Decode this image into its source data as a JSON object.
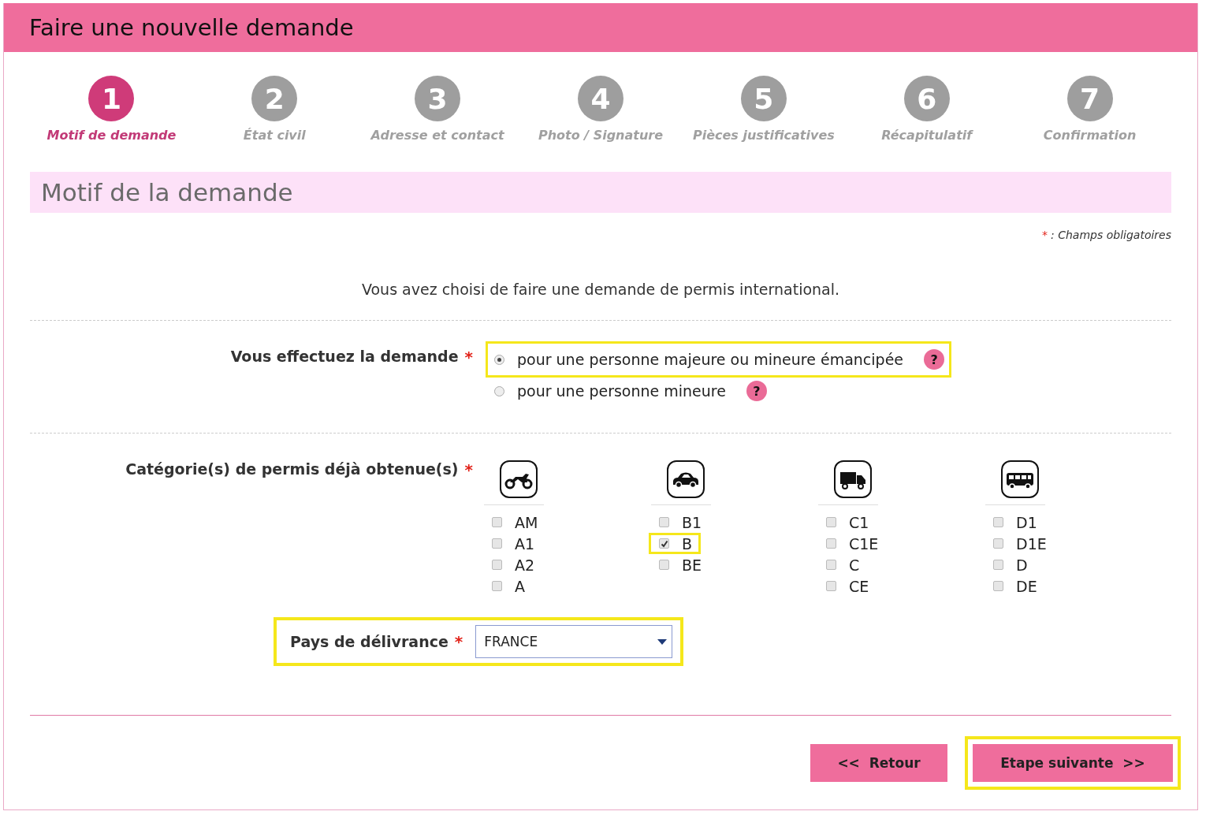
{
  "header": {
    "title": "Faire une nouvelle demande"
  },
  "steps": [
    {
      "number": "1",
      "label": "Motif de demande",
      "selected": true
    },
    {
      "number": "2",
      "label": "État civil",
      "selected": false
    },
    {
      "number": "3",
      "label": "Adresse et contact",
      "selected": false
    },
    {
      "number": "4",
      "label": "Photo / Signature",
      "selected": false
    },
    {
      "number": "5",
      "label": "Pièces justificatives",
      "selected": false
    },
    {
      "number": "6",
      "label": "Récapitulatif",
      "selected": false
    },
    {
      "number": "7",
      "label": "Confirmation",
      "selected": false
    }
  ],
  "section_title": "Motif de la demande",
  "required_note": {
    "mark": "*",
    "text": ": Champs obligatoires"
  },
  "intro": "Vous avez choisi de faire une demande de permis international.",
  "requester": {
    "label": "Vous effectuez la demande",
    "required": "*",
    "options": [
      {
        "label": "pour une personne majeure ou mineure émancipée",
        "selected": true,
        "highlighted": true,
        "help": "?"
      },
      {
        "label": "pour une personne mineure",
        "selected": false,
        "highlighted": false,
        "help": "?"
      }
    ]
  },
  "categories": {
    "label": "Catégorie(s) de permis déjà obtenue(s)",
    "required": "*",
    "groups": [
      {
        "kind": "motorcycle",
        "items": [
          {
            "label": "AM",
            "checked": false,
            "highlighted": false
          },
          {
            "label": "A1",
            "checked": false,
            "highlighted": false
          },
          {
            "label": "A2",
            "checked": false,
            "highlighted": false
          },
          {
            "label": "A",
            "checked": false,
            "highlighted": false
          }
        ]
      },
      {
        "kind": "car",
        "items": [
          {
            "label": "B1",
            "checked": false,
            "highlighted": false
          },
          {
            "label": "B",
            "checked": true,
            "highlighted": true
          },
          {
            "label": "BE",
            "checked": false,
            "highlighted": false
          }
        ]
      },
      {
        "kind": "truck",
        "items": [
          {
            "label": "C1",
            "checked": false,
            "highlighted": false
          },
          {
            "label": "C1E",
            "checked": false,
            "highlighted": false
          },
          {
            "label": "C",
            "checked": false,
            "highlighted": false
          },
          {
            "label": "CE",
            "checked": false,
            "highlighted": false
          }
        ]
      },
      {
        "kind": "bus",
        "items": [
          {
            "label": "D1",
            "checked": false,
            "highlighted": false
          },
          {
            "label": "D1E",
            "checked": false,
            "highlighted": false
          },
          {
            "label": "D",
            "checked": false,
            "highlighted": false
          },
          {
            "label": "DE",
            "checked": false,
            "highlighted": false
          }
        ]
      }
    ]
  },
  "country": {
    "label": "Pays de délivrance",
    "required": "*",
    "value": "FRANCE",
    "highlighted": true
  },
  "buttons": [
    {
      "kind": "back",
      "label": "<<  Retour",
      "highlighted": false
    },
    {
      "kind": "next",
      "label": "Etape suivante  >>",
      "highlighted": true
    }
  ]
}
